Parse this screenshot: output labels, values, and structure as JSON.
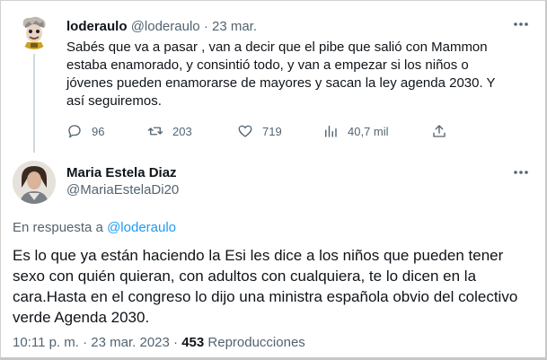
{
  "parent_tweet": {
    "display_name": "loderaulo",
    "handle": "@loderaulo",
    "separator": "·",
    "date": "23 mar.",
    "text": "Sabés que va a pasar , van a decir que el pibe que salió con Mammon estaba enamorado, y consintió todo, y van a empezar si los niños o jóvenes pueden enamorarse de mayores y sacan la ley  agenda 2030. Y así seguiremos.",
    "replies": "96",
    "retweets": "203",
    "likes": "719",
    "views": "40,7 mil",
    "icons": [
      "reply-icon",
      "retweet-icon",
      "like-icon",
      "views-icon",
      "share-icon",
      "more-icon"
    ]
  },
  "main_tweet": {
    "display_name": "Maria Estela Diaz",
    "handle": "@MariaEstelaDi20",
    "reply_prefix": "En respuesta a",
    "reply_handle": "@loderaulo",
    "text": "Es lo que ya están haciendo la Esi les dice a los niños que pueden tener sexo con quién quieran, con adultos con cualquiera, te lo dicen en la cara.Hasta en el congreso lo dijo una ministra española obvio del colectivo verde Agenda 2030.",
    "time": "10:11 p. m.",
    "separator": "·",
    "date": "23 mar. 2023",
    "separator2": "·",
    "views_count": "453",
    "views_label": "Reproducciones"
  },
  "colors": {
    "text": "#0f1419",
    "secondary": "#536471",
    "link": "#1d9bf0",
    "thread_line": "#cfd9de"
  }
}
